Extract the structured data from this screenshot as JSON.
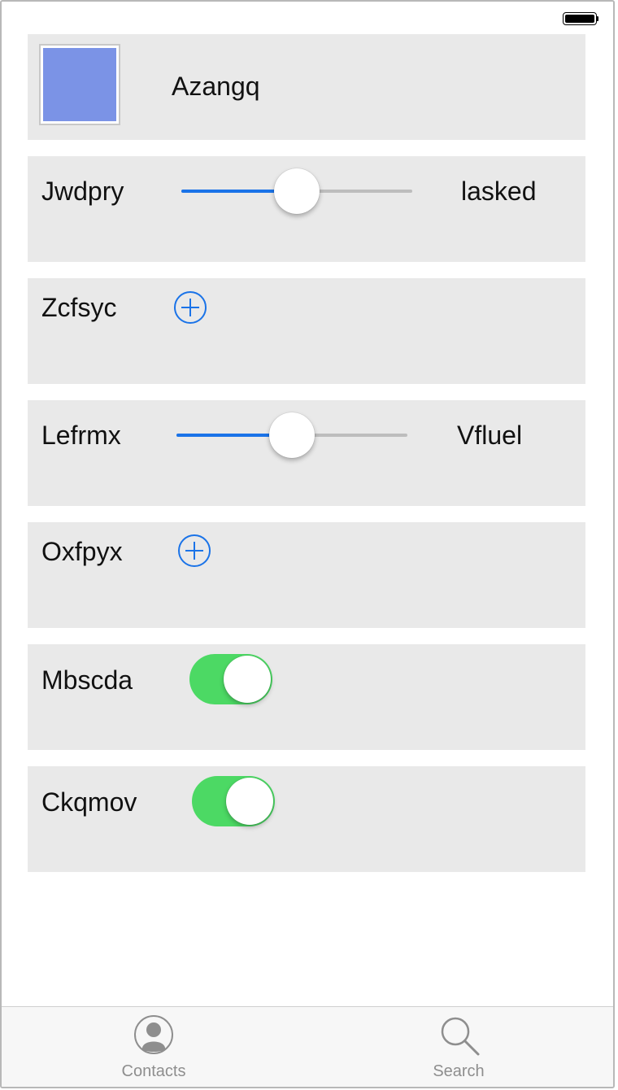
{
  "status_bar": {
    "battery_icon": "battery-full-icon"
  },
  "rows": [
    {
      "type": "image",
      "label": "Azangq",
      "swatch_color": "#7b93e6"
    },
    {
      "type": "slider",
      "label": "Jwdpry",
      "value_label": "lasked",
      "value_fraction": 0.5
    },
    {
      "type": "add",
      "label": "Zcfsyc",
      "icon": "plus-circle-icon"
    },
    {
      "type": "slider",
      "label": "Lefrmx",
      "value_label": "Vfluel",
      "value_fraction": 0.5
    },
    {
      "type": "add",
      "label": "Oxfpyx",
      "icon": "plus-circle-icon"
    },
    {
      "type": "toggle",
      "label": "Mbscda",
      "on": true
    },
    {
      "type": "toggle",
      "label": "Ckqmov",
      "on": true
    }
  ],
  "colors": {
    "accent": "#1a73e8",
    "toggle_on": "#4cd964",
    "card_bg": "#e9e9e9"
  },
  "tabbar": {
    "tabs": [
      {
        "label": "Contacts",
        "icon": "contacts-icon"
      },
      {
        "label": "Search",
        "icon": "search-icon"
      }
    ]
  }
}
